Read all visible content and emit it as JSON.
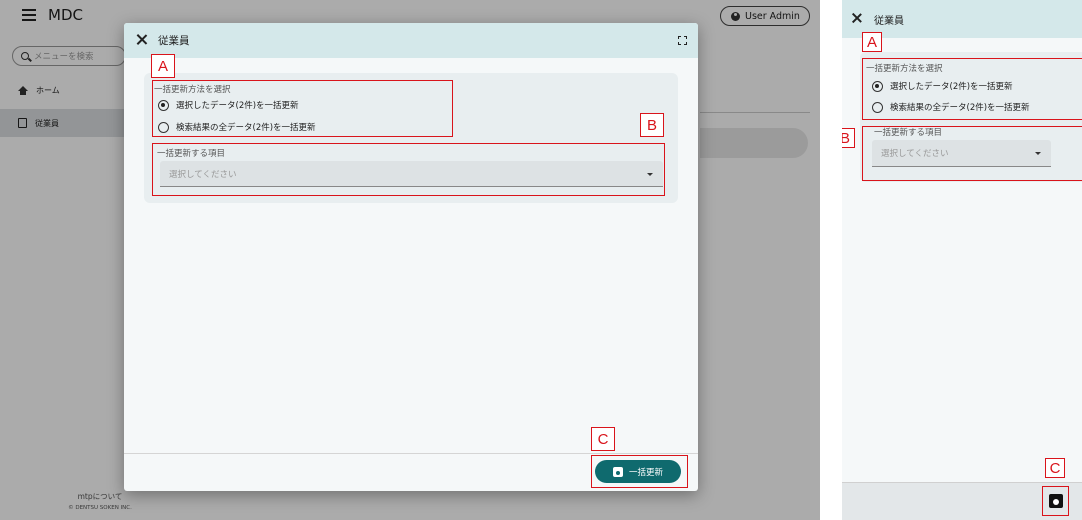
{
  "desktop": {
    "header": {
      "title": "MDC",
      "user_label": "User Admin"
    },
    "sidebar": {
      "search_placeholder": "メニューを検索",
      "items": [
        {
          "label": "ホーム",
          "icon": "home-icon",
          "active": false
        },
        {
          "label": "従業員",
          "icon": "document-icon",
          "active": true
        }
      ],
      "footer_link": "mtpについて",
      "copyright": "© DENTSU SOKEN INC."
    },
    "dialog": {
      "title": "従業員",
      "method_legend": "一括更新方法を選択",
      "options": [
        {
          "label": "選択したデータ(2件)を一括更新",
          "checked": true
        },
        {
          "label": "検索結果の全データ(2件)を一括更新",
          "checked": false
        }
      ],
      "field_legend": "一括更新する項目",
      "field_placeholder": "選択してください",
      "submit_label": "一括更新"
    }
  },
  "mobile": {
    "title": "従業員",
    "method_legend": "一括更新方法を選択",
    "options": [
      {
        "label": "選択したデータ(2件)を一括更新",
        "checked": true
      },
      {
        "label": "検索結果の全データ(2件)を一括更新",
        "checked": false
      }
    ],
    "field_legend": "一括更新する項目",
    "field_placeholder": "選択してください"
  },
  "annotations": {
    "a": "A",
    "b": "B",
    "c": "C"
  },
  "colors": {
    "primary": "#0f6a6e",
    "header_bg": "#d4e8ea",
    "annotation": "#d9141b"
  }
}
